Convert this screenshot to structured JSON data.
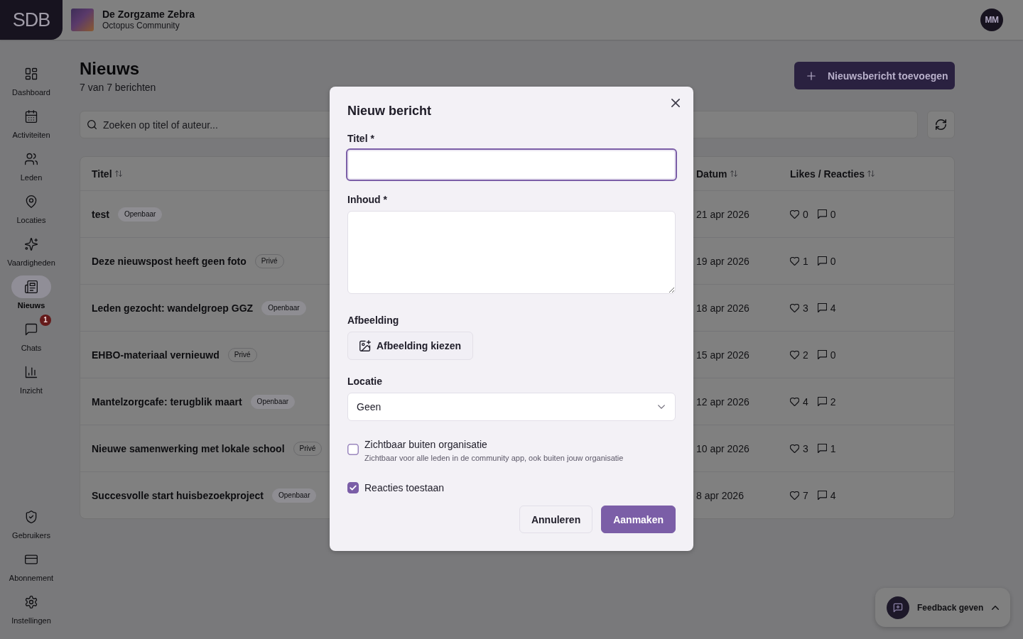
{
  "header": {
    "logo": "SDB",
    "org_name": "De Zorgzame Zebra",
    "org_subtitle": "Octopus Community",
    "user_initials": "MM"
  },
  "sidebar": {
    "items": [
      {
        "label": "Dashboard",
        "selected": false
      },
      {
        "label": "Activiteiten",
        "selected": false
      },
      {
        "label": "Leden",
        "selected": false
      },
      {
        "label": "Locaties",
        "selected": false
      },
      {
        "label": "Vaardigheden",
        "selected": false
      },
      {
        "label": "Nieuws",
        "selected": true
      },
      {
        "label": "Chats",
        "selected": false,
        "badge": "1"
      },
      {
        "label": "Inzicht",
        "selected": false
      }
    ],
    "bottom_items": [
      {
        "label": "Gebruikers",
        "selected": false
      },
      {
        "label": "Abonnement",
        "selected": false
      },
      {
        "label": "Instellingen",
        "selected": false
      }
    ]
  },
  "page": {
    "title": "Nieuws",
    "subtitle": "7 van 7 berichten",
    "add_button": "Nieuwsbericht toevoegen",
    "search": {
      "placeholder": "Zoeken op titel of auteur..."
    }
  },
  "table": {
    "columns": [
      "Titel",
      "Datum",
      "Likes / Reacties"
    ],
    "rows": [
      {
        "title": {
          "text": "test",
          "badge": {
            "label": "Openbaar",
            "kind": "filled"
          }
        },
        "date": "21 apr 2026",
        "likes": "0",
        "reactions": "0"
      },
      {
        "title": {
          "text": "Deze nieuwspost heeft geen foto",
          "badge": {
            "label": "Privé",
            "kind": "outline"
          }
        },
        "date": "19 apr 2026",
        "likes": "1",
        "reactions": "0"
      },
      {
        "title": {
          "text": "Leden gezocht: wandelgroep GGZ",
          "badge": {
            "label": "Openbaar",
            "kind": "filled"
          }
        },
        "date": "18 apr 2026",
        "likes": "3",
        "reactions": "4"
      },
      {
        "title": {
          "text": "EHBO-materiaal vernieuwd",
          "badge": {
            "label": "Privé",
            "kind": "outline"
          }
        },
        "date": "15 apr 2026",
        "likes": "2",
        "reactions": "0"
      },
      {
        "title": {
          "text": "Mantelzorgcafe: terugblik maart",
          "badge": {
            "label": "Openbaar",
            "kind": "filled"
          }
        },
        "date": "12 apr 2026",
        "likes": "4",
        "reactions": "2"
      },
      {
        "title": {
          "text": "Nieuwe samenwerking met lokale school",
          "badge": {
            "label": "Privé",
            "kind": "outline"
          }
        },
        "date": "10 apr 2026",
        "likes": "3",
        "reactions": "1"
      },
      {
        "title": {
          "text": "Succesvolle start huisbezoekproject",
          "badge": {
            "label": "Openbaar",
            "kind": "filled"
          }
        },
        "date": "8 apr 2026",
        "likes": "7",
        "reactions": "4"
      }
    ]
  },
  "dialog": {
    "title": "Nieuw bericht",
    "fields": [
      {
        "kind": "text",
        "label": "Titel *",
        "focused": true
      },
      {
        "kind": "textarea",
        "label": "Inhoud *",
        "focused": false
      },
      {
        "kind": "file",
        "label": "Afbeelding",
        "button": "Afbeelding kiezen"
      },
      {
        "kind": "select",
        "label": "Locatie",
        "value": "Geen",
        "focused": false
      }
    ],
    "checkboxes": [
      {
        "label": "Zichtbaar buiten organisatie",
        "hint": "Zichtbaar voor alle leden in de community app, ook buiten jouw organisatie",
        "checked": false
      },
      {
        "label": "Reacties toestaan",
        "checked": true
      }
    ],
    "buttons": [
      {
        "label": "Annuleren",
        "kind": "secondary"
      },
      {
        "label": "Aanmaken",
        "kind": "primary"
      }
    ]
  },
  "feedback": {
    "label": "Feedback geven"
  }
}
